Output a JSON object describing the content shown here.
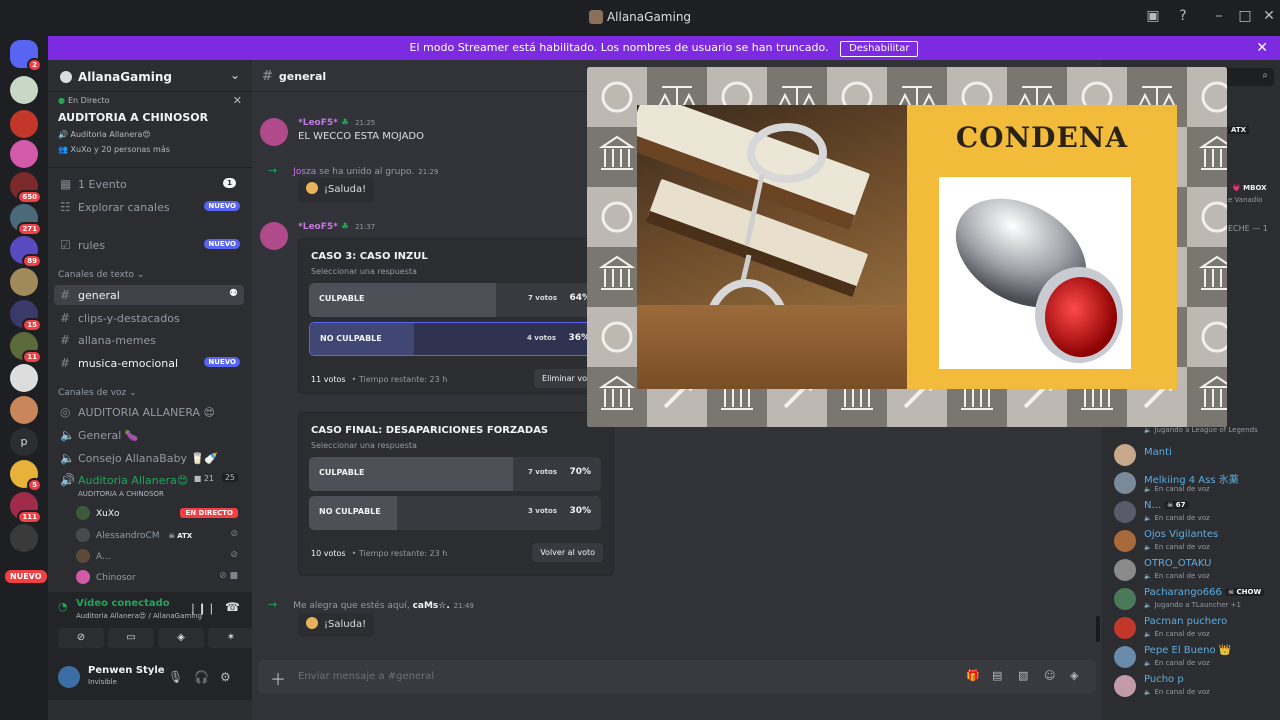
{
  "window": {
    "title": "AllanaGaming"
  },
  "banner": {
    "text": "El modo Streamer está habilitado. Los nombres de usuario se han truncado.",
    "button": "Deshabilitar"
  },
  "guild_badges": [
    "2",
    "650",
    "271",
    "89",
    "15",
    "11",
    "5",
    "111"
  ],
  "guild_text": {
    "p": "p",
    "nuevo": "NUEVO"
  },
  "server": {
    "name": "AllanaGaming",
    "event": {
      "status": "En Directo",
      "title": "AUDITORIA A CHINOSOR",
      "channel": "Auditoria Allanera😍",
      "people": "XuXo y 20 personas más"
    },
    "items": [
      {
        "label": "1 Evento",
        "count": "1"
      },
      {
        "label": "Explorar canales",
        "tag": "NUEVO"
      },
      {
        "label": "rules",
        "tag": "NUEVO"
      }
    ],
    "text_category": "Canales de texto",
    "text_channels": [
      {
        "label": "general"
      },
      {
        "label": "clips-y-destacados"
      },
      {
        "label": "allana-memes"
      },
      {
        "label": "musica-emocional",
        "tag": "NUEVO"
      }
    ],
    "voice_category": "Canales de voz",
    "voice_channels": [
      {
        "label": "AUDITORIA ALLANERA 😍"
      },
      {
        "label": "General 🍆"
      },
      {
        "label": "Consejo AllanaBaby 🥛🍼"
      },
      {
        "label": "Auditoria Allanera😍",
        "sub": "AUDITORIA A CHINOSOR",
        "cam": "21",
        "users": "25"
      }
    ],
    "voice_users": [
      {
        "name": "XuXo",
        "live": "EN DIRECTO"
      },
      {
        "name": "AlessandroCM",
        "tag": "ATX"
      },
      {
        "name": "A..."
      },
      {
        "name": "Chinosor"
      }
    ]
  },
  "voice_panel": {
    "status": "Vídeo conectado",
    "sub": "Auditoria Allanera😍 / AllanaGaming"
  },
  "user": {
    "name": "Penwen Style",
    "status": "Invisible"
  },
  "channel": {
    "name": "general"
  },
  "messages": {
    "m1": {
      "author": "*LeoF5*",
      "time": "21:25",
      "text": "EL WECCO ESTA MOJADO"
    },
    "join1": {
      "name": "Josza",
      "text": "se ha unido al grupo.",
      "time": "21:29"
    },
    "m2": {
      "author": "*LeoF5*",
      "time": "21:37"
    },
    "join2": {
      "text": "Me alegra que estés aquí,",
      "name": "caMs☆.",
      "time": "21:49"
    },
    "saluda": "¡Saluda!"
  },
  "polls": [
    {
      "question": "CASO 3: CASO INZUL",
      "select": "Seleccionar una respuesta",
      "options": [
        {
          "label": "CULPABLE",
          "votes": "7 votos",
          "pct": "64%",
          "fraction": 0.64
        },
        {
          "label": "NO CULPABLE",
          "votes": "4 votos",
          "pct": "36%",
          "fraction": 0.36
        }
      ],
      "total": "11 votos",
      "remaining": "Tiempo restante: 23 h",
      "action": "Eliminar voto"
    },
    {
      "question": "CASO FINAL: DESAPARICIONES FORZADAS",
      "select": "Seleccionar una respuesta",
      "options": [
        {
          "label": "CULPABLE",
          "votes": "7 votos",
          "pct": "70%",
          "fraction": 0.7
        },
        {
          "label": "NO CULPABLE",
          "votes": "3 votos",
          "pct": "30%",
          "fraction": 0.3
        }
      ],
      "total": "10 votos",
      "remaining": "Tiempo restante: 23 h",
      "action": "Volver al voto"
    }
  ],
  "composer": {
    "placeholder": "Enviar mensaje a #general"
  },
  "members_partial": {
    "atx": "ATX",
    "mbox": "MBOX",
    "vanadio": "e Vanadio",
    "eche": "ECHE — 1"
  },
  "members": [
    {
      "name": "",
      "status": "Jugando a League of Legends"
    },
    {
      "name": "Manti",
      "status": ""
    },
    {
      "name": "Melkiing 4 Ass 氷薬",
      "status": "En canal de voz"
    },
    {
      "name": "N...",
      "tag": "67",
      "status": "En canal de voz"
    },
    {
      "name": "Ojos Vigilantes",
      "status": "En canal de voz"
    },
    {
      "name": "OTRO_OTAKU",
      "status": "En canal de voz"
    },
    {
      "name": "Pacharango666",
      "tag": "CHOW",
      "status": "Jugando a TLauncher +1"
    },
    {
      "name": "Pacman puchero",
      "status": "En canal de voz"
    },
    {
      "name": "Pepe El Bueno 👑",
      "status": "En canal de voz"
    },
    {
      "name": "Pucho p",
      "status": "En canal de voz"
    }
  ],
  "popup": {
    "title": "CONDENA"
  }
}
